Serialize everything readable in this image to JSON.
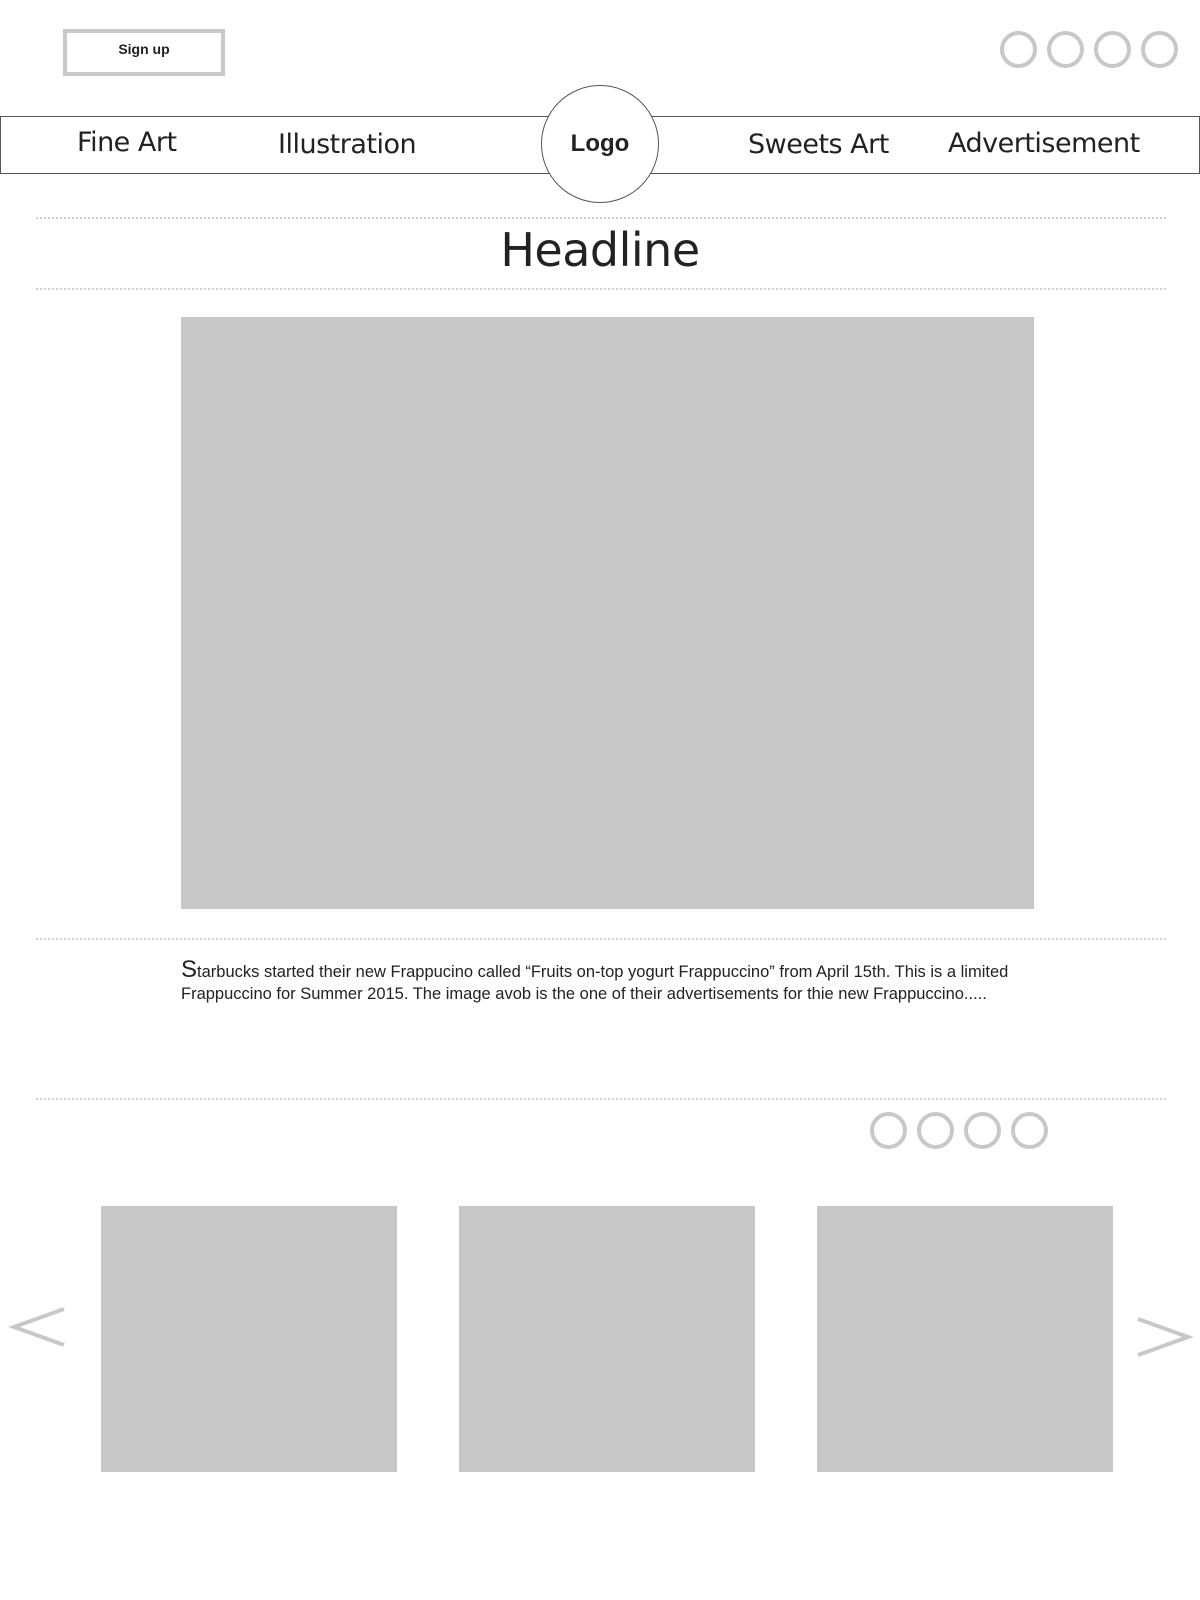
{
  "header": {
    "signup_label": "Sign up",
    "social_icons": [
      "circle-icon",
      "circle-icon",
      "circle-icon",
      "circle-icon"
    ]
  },
  "nav": {
    "items": [
      {
        "label": "Fine Art"
      },
      {
        "label": "Illustration"
      },
      {
        "label": "Sweets Art"
      },
      {
        "label": "Advertisement"
      }
    ],
    "logo_label": "Logo"
  },
  "article": {
    "headline": "Headline",
    "body_first_letter": "S",
    "body_rest": "tarbucks started their new Frappucino called “Fruits on-top yogurt Frappuccino” from April 15th. This is a limited Frappuccino for Summer 2015. The image avob is the one of their advertisements for thie new Frappuccino....."
  },
  "colors": {
    "placeholder_gray": "#c7c7c7",
    "outline_gray": "#c8c8c8",
    "text": "#222222"
  },
  "carousel": {
    "prev_icon": "chevron-left-icon",
    "next_icon": "chevron-right-icon"
  }
}
